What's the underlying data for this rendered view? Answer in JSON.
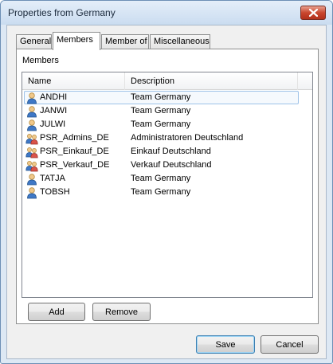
{
  "window": {
    "title": "Properties from Germany"
  },
  "tabs": [
    {
      "label": "General",
      "active": false
    },
    {
      "label": "Members",
      "active": true
    },
    {
      "label": "Member of",
      "active": false
    },
    {
      "label": "Miscellaneous",
      "active": false
    }
  ],
  "members_group": {
    "label": "Members"
  },
  "columns": {
    "name": "Name",
    "description": "Description"
  },
  "rows": [
    {
      "name": "ANDHI",
      "description": "Team Germany",
      "icon": "user-icon"
    },
    {
      "name": "JANWI",
      "description": "Team Germany",
      "icon": "user-icon"
    },
    {
      "name": "JULWI",
      "description": "Team Germany",
      "icon": "user-icon"
    },
    {
      "name": "PSR_Admins_DE",
      "description": "Administratoren Deutschland",
      "icon": "group-icon"
    },
    {
      "name": "PSR_Einkauf_DE",
      "description": "Einkauf Deutschland",
      "icon": "group-icon"
    },
    {
      "name": "PSR_Verkauf_DE",
      "description": "Verkauf Deutschland",
      "icon": "group-icon"
    },
    {
      "name": "TATJA",
      "description": "Team Germany",
      "icon": "user-icon"
    },
    {
      "name": "TOBSH",
      "description": "Team Germany",
      "icon": "user-icon"
    }
  ],
  "buttons": {
    "add": "Add",
    "remove": "Remove",
    "save": "Save",
    "cancel": "Cancel"
  },
  "colors": {
    "title_bar": "#cadcf0",
    "close_button": "#c9462e",
    "focus_border": "#9ec2e8"
  }
}
